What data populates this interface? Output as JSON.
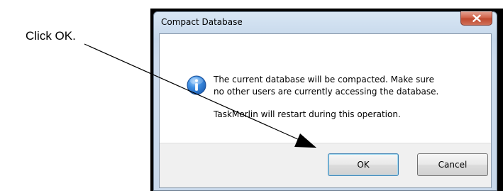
{
  "callout": {
    "text": "Click OK."
  },
  "dialog": {
    "title": "Compact Database",
    "message_line1": "The current database will be compacted. Make sure",
    "message_line2": "no other users are currently accessing the database.",
    "message_line3": "TaskMerlin will restart during this operation.",
    "icon": "information-icon",
    "close_icon": "close-icon",
    "ok_label": "OK",
    "cancel_label": "Cancel"
  },
  "colors": {
    "close_button_red": "#c04a2f",
    "info_icon_blue": "#1d5fb4",
    "window_frame": "#c6d8eb"
  }
}
